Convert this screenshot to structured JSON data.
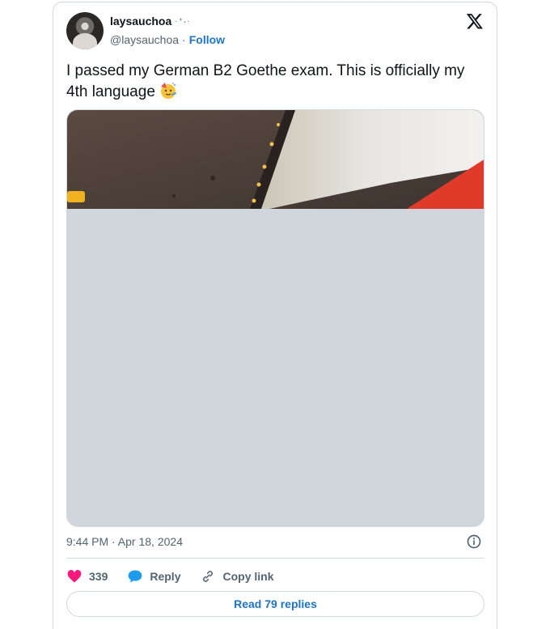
{
  "author": {
    "display_name": "laysauchoa",
    "name_decoration": "·⁺˖·",
    "handle": "@laysauchoa",
    "separator": "·",
    "follow_label": "Follow"
  },
  "tweet": {
    "text": "I passed my German B2 Goethe exam. This is officially my 4th language",
    "emoji": "partying-face-emoji",
    "timestamp": "9:44 PM · Apr 18, 2024"
  },
  "actions": {
    "likes_count": "339",
    "reply_label": "Reply",
    "copy_link_label": "Copy link"
  },
  "read_replies_label": "Read 79 replies",
  "icons": [
    "x-logo-icon",
    "info-icon",
    "heart-icon",
    "reply-bubble-icon",
    "link-icon"
  ],
  "colors": {
    "link": "#1d74c5",
    "heart": "#f91880",
    "reply": "#1d9bf0",
    "border": "#cfd9de",
    "secondary_text": "#536471"
  }
}
